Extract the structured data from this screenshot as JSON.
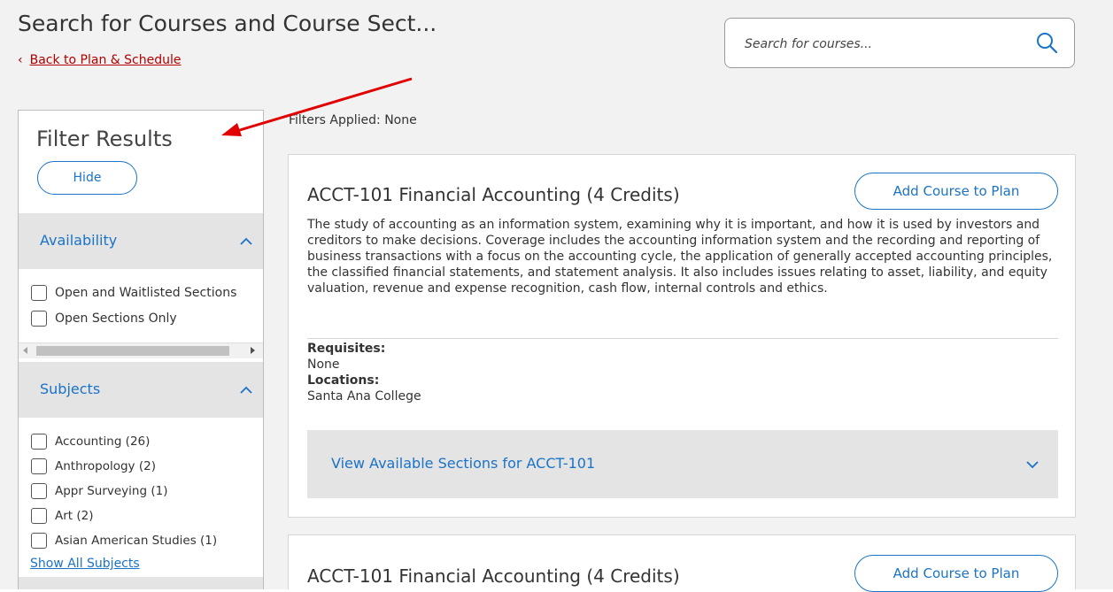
{
  "header": {
    "title": "Search for Courses and Course Sect...",
    "back_link": "Back to Plan & Schedule",
    "search_placeholder": "Search for courses..."
  },
  "filter_panel": {
    "title": "Filter Results",
    "hide_label": "Hide",
    "availability": {
      "label": "Availability",
      "options": [
        "Open and Waitlisted Sections",
        "Open Sections Only"
      ]
    },
    "subjects": {
      "label": "Subjects",
      "options": [
        "Accounting (26)",
        "Anthropology (2)",
        "Appr Surveying (1)",
        "Art (2)",
        "Asian American Studies (1)"
      ],
      "show_all": "Show All Subjects"
    }
  },
  "results": {
    "filters_applied": "Filters Applied: None",
    "courses": [
      {
        "title": "ACCT-101 Financial Accounting (4 Credits)",
        "add_label": "Add Course to Plan",
        "description": "The study of accounting as an information system, examining why it is important, and how it is used by investors and creditors to make decisions. Coverage includes the accounting information system and the recording and reporting of business transactions with a focus on the accounting cycle, the application of generally accepted accounting principles, the classified financial statements, and statement analysis. It also includes issues relating to asset, liability, and equity valuation, revenue and expense recognition, cash flow, internal controls and ethics.",
        "requisites_label": "Requisites:",
        "requisites_value": "None",
        "locations_label": "Locations:",
        "locations_value": "Santa Ana College",
        "sections_label": "View Available Sections for ACCT-101"
      },
      {
        "title": "ACCT-101 Financial Accounting (4 Credits)",
        "add_label": "Add Course to Plan"
      }
    ]
  },
  "colors": {
    "accent_blue": "#1a73c7",
    "link_red": "#b00000",
    "annotation_arrow": "#e00000",
    "header_gray": "#f2f2f2",
    "section_gray": "#e4e4e4"
  }
}
